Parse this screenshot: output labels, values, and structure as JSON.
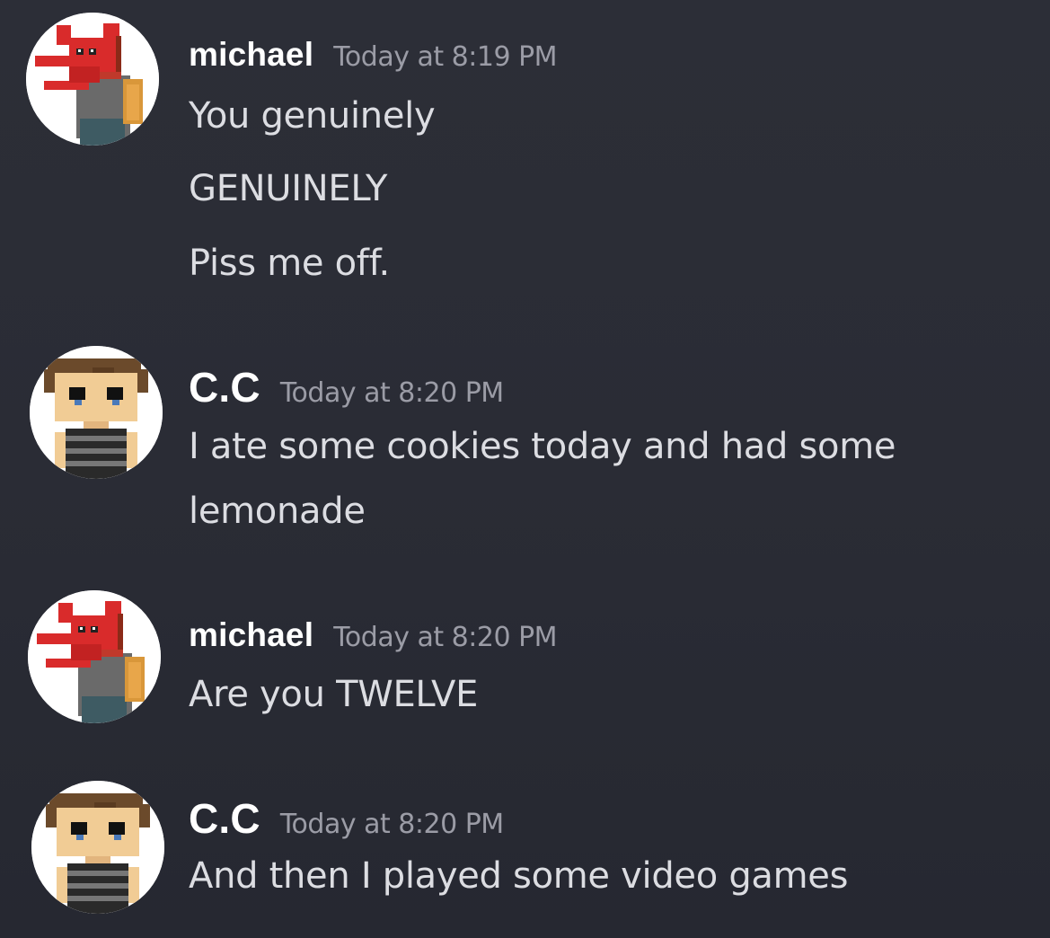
{
  "messages": [
    {
      "username": "michael",
      "timestamp": "Today at 8:19 PM",
      "avatar": "michael-avatar-icon",
      "lines": [
        "You genuinely",
        "GENUINELY",
        "Piss me off."
      ]
    },
    {
      "username": "C.C",
      "timestamp": "Today at 8:20 PM",
      "avatar": "cc-avatar-icon",
      "lines": [
        "I ate some cookies today and had some",
        "lemonade"
      ]
    },
    {
      "username": "michael",
      "timestamp": "Today at 8:20 PM",
      "avatar": "michael-avatar-icon",
      "lines": [
        "Are you TWELVE"
      ]
    },
    {
      "username": "C.C",
      "timestamp": "Today at 8:20 PM",
      "avatar": "cc-avatar-icon",
      "lines": [
        "And then I played some video games"
      ]
    }
  ],
  "colors": {
    "background": "#2b2d36",
    "username": "#ffffff",
    "timestamp": "#9b9ca6",
    "message_text": "#dcdde2"
  }
}
